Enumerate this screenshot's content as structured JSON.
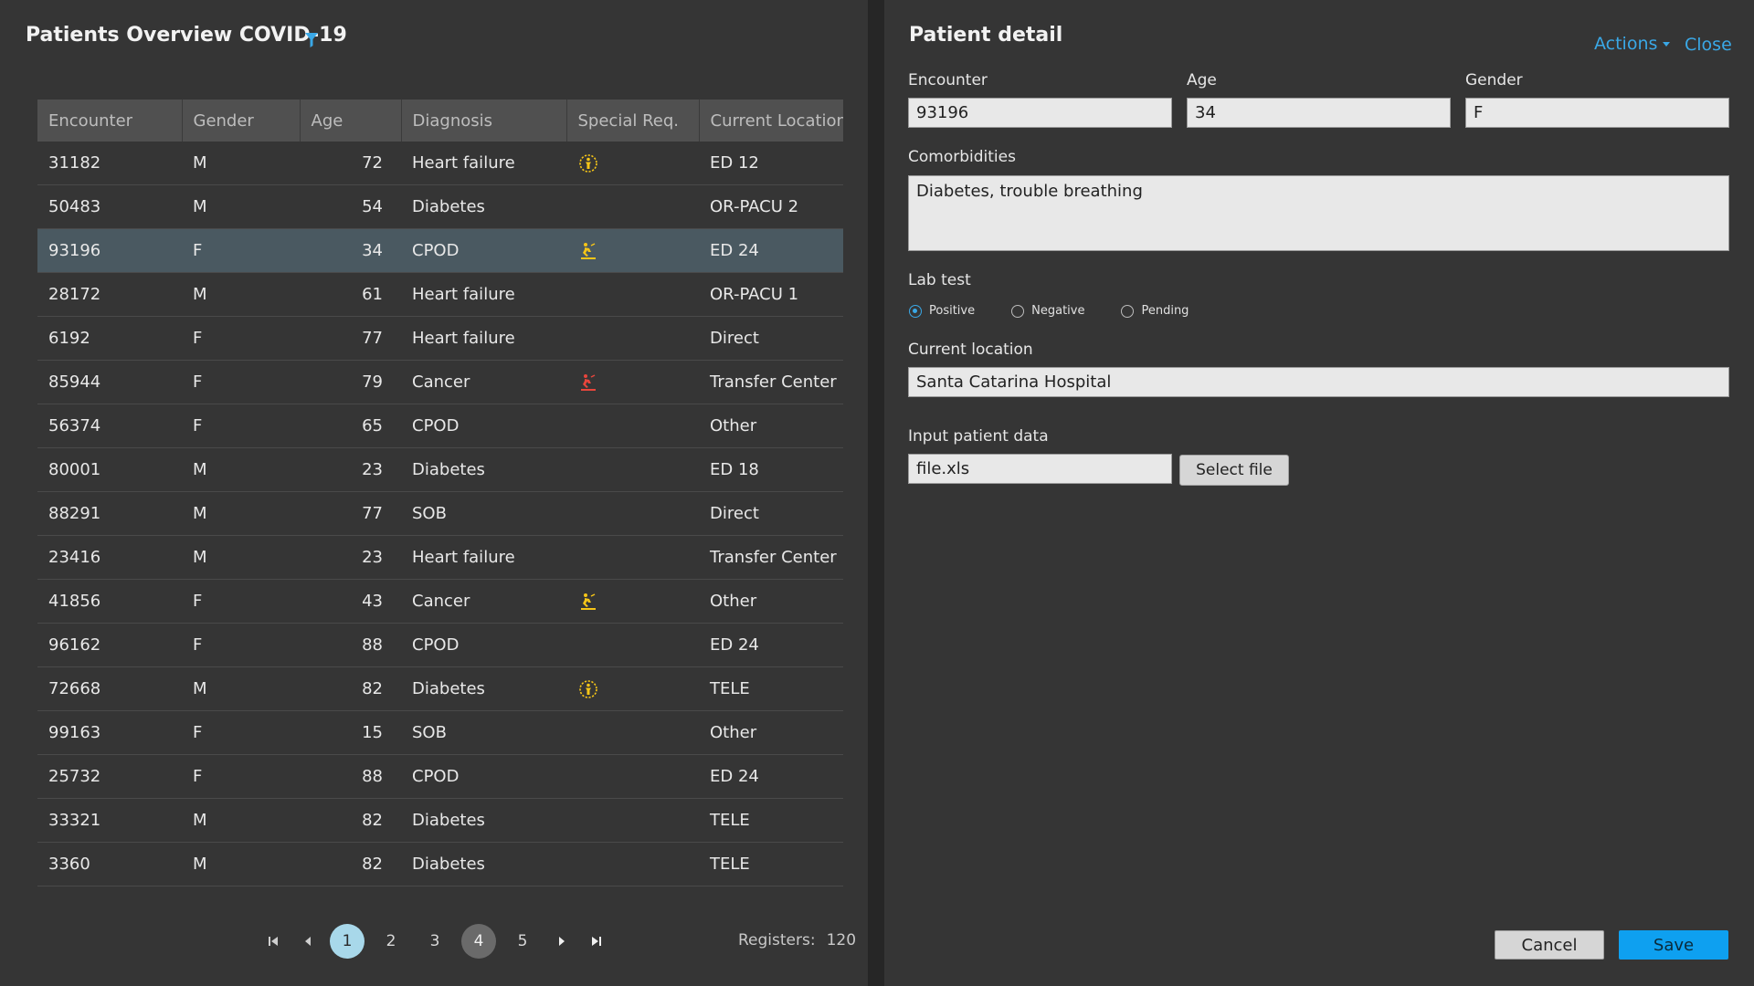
{
  "overview": {
    "title": "Patients Overview COVID-19",
    "filter_icon": "filter-icon",
    "columns": [
      "Encounter",
      "Gender",
      "Age",
      "Diagnosis",
      "Special Req.",
      "Current Location"
    ],
    "rows": [
      {
        "encounter": "31182",
        "gender": "M",
        "age": "72",
        "diagnosis": "Heart failure",
        "special": "person-alert-icon",
        "location": "ED 12"
      },
      {
        "encounter": "50483",
        "gender": "M",
        "age": "54",
        "diagnosis": "Diabetes",
        "special": "",
        "location": "OR-PACU 2"
      },
      {
        "encounter": "93196",
        "gender": "F",
        "age": "34",
        "diagnosis": "CPOD",
        "special": "fall-risk-icon",
        "location": "ED 24",
        "selected": true
      },
      {
        "encounter": "28172",
        "gender": "M",
        "age": "61",
        "diagnosis": "Heart failure",
        "special": "",
        "location": "OR-PACU 1"
      },
      {
        "encounter": "6192",
        "gender": "F",
        "age": "77",
        "diagnosis": "Heart failure",
        "special": "",
        "location": "Direct"
      },
      {
        "encounter": "85944",
        "gender": "F",
        "age": "79",
        "diagnosis": "Cancer",
        "special": "fall-risk-red-icon",
        "location": "Transfer Center"
      },
      {
        "encounter": "56374",
        "gender": "F",
        "age": "65",
        "diagnosis": "CPOD",
        "special": "",
        "location": "Other"
      },
      {
        "encounter": "80001",
        "gender": "M",
        "age": "23",
        "diagnosis": "Diabetes",
        "special": "",
        "location": "ED 18"
      },
      {
        "encounter": "88291",
        "gender": "M",
        "age": "77",
        "diagnosis": "SOB",
        "special": "",
        "location": "Direct"
      },
      {
        "encounter": "23416",
        "gender": "M",
        "age": "23",
        "diagnosis": "Heart failure",
        "special": "",
        "location": "Transfer Center"
      },
      {
        "encounter": "41856",
        "gender": "F",
        "age": "43",
        "diagnosis": "Cancer",
        "special": "fall-risk-icon",
        "location": "Other"
      },
      {
        "encounter": "96162",
        "gender": "F",
        "age": "88",
        "diagnosis": "CPOD",
        "special": "",
        "location": "ED 24"
      },
      {
        "encounter": "72668",
        "gender": "M",
        "age": "82",
        "diagnosis": "Diabetes",
        "special": "person-alert-icon",
        "location": "TELE"
      },
      {
        "encounter": "99163",
        "gender": "F",
        "age": "15",
        "diagnosis": "SOB",
        "special": "",
        "location": "Other"
      },
      {
        "encounter": "25732",
        "gender": "F",
        "age": "88",
        "diagnosis": "CPOD",
        "special": "",
        "location": "ED 24"
      },
      {
        "encounter": "33321",
        "gender": "M",
        "age": "82",
        "diagnosis": "Diabetes",
        "special": "",
        "location": "TELE"
      },
      {
        "encounter": "3360",
        "gender": "M",
        "age": "82",
        "diagnosis": "Diabetes",
        "special": "",
        "location": "TELE"
      }
    ],
    "pagination": {
      "pages": [
        "1",
        "2",
        "3",
        "4",
        "5"
      ],
      "current": "1",
      "highlighted": "4",
      "registers_label": "Registers:",
      "registers_value": "120"
    }
  },
  "detail": {
    "title": "Patient detail",
    "actions_label": "Actions",
    "close_label": "Close",
    "encounter_label": "Encounter",
    "encounter_value": "93196",
    "age_label": "Age",
    "age_value": "34",
    "gender_label": "Gender",
    "gender_value": "F",
    "comorbidities_label": "Comorbidities",
    "comorbidities_value": "Diabetes, trouble breathing",
    "lab_test_label": "Lab test",
    "lab_options": [
      "Positive",
      "Negative",
      "Pending"
    ],
    "lab_selected": "Positive",
    "location_label": "Current location",
    "location_value": "Santa Catarina Hospital",
    "input_label": "Input patient data",
    "file_value": "file.xls",
    "select_file_label": "Select file",
    "cancel_label": "Cancel",
    "save_label": "Save"
  },
  "colors": {
    "accent": "#3aa8e6",
    "save_button": "#0ea0f0",
    "selected_row": "#4a5961",
    "warning_icon": "#f5c518",
    "danger_icon": "#e8453c"
  }
}
